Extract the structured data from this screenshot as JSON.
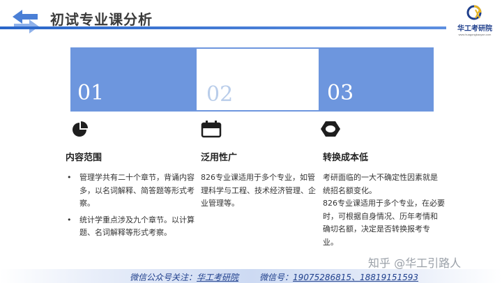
{
  "header": {
    "title": "初试专业课分析",
    "logo_name": "华工考研院",
    "logo_url": "www.huagongkaoyan.com"
  },
  "numbers": [
    "01",
    "02",
    "03"
  ],
  "columns": [
    {
      "icon": "pie-chart-icon",
      "heading": "内容范围",
      "bullets": [
        "管理学共有二十个章节，背诵内容多，以名词解释、简答题等形式考察。",
        "统计学重点涉及九个章节。以计算题、名词解释等形式考察。"
      ]
    },
    {
      "icon": "calendar-icon",
      "heading": "泛用性广",
      "paragraphs": [
        "826专业课适用于多个专业，如管理科学与工程、技术经济管理、企业管理等。"
      ]
    },
    {
      "icon": "hexagon-nut-icon",
      "heading": "转换成本低",
      "paragraphs": [
        "考研面临的一大不确定性因素就是统招名额变化。",
        "826专业课适用于多个专业，在必要时，可根据自身情况、历年考情和确切名额，决定是否转换报考专业。"
      ]
    }
  ],
  "watermark": "知乎 @华工引路人",
  "footer": {
    "wechat_label": "微信公众号关注：",
    "wechat_name": "华工考研院",
    "phone_label": "微信号：",
    "phones": "19075286815、18819151593"
  },
  "colors": {
    "accent": "#6d96de",
    "header_bar": "#2a66c9",
    "footer_text": "#1f3f8c"
  }
}
